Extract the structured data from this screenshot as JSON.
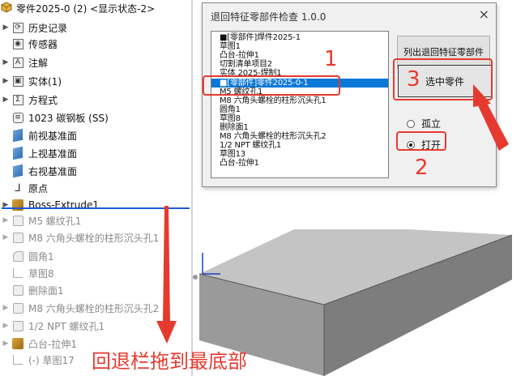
{
  "tree": {
    "header": "零件2025-0 (2) <显示状态-2>",
    "items": [
      {
        "label": "历史记录",
        "icon": "history-icon",
        "expandable": true,
        "dim": false
      },
      {
        "label": "传感器",
        "icon": "sensor-icon",
        "expandable": false,
        "dim": false
      },
      {
        "label": "注解",
        "icon": "annotation-icon",
        "expandable": true,
        "dim": false
      },
      {
        "label": "实体(1)",
        "icon": "solid-bodies-icon",
        "expandable": true,
        "dim": false
      },
      {
        "label": "方程式",
        "icon": "equations-icon",
        "expandable": true,
        "dim": false
      },
      {
        "label": "1023 碳钢板 (SS)",
        "icon": "material-icon",
        "expandable": false,
        "dim": false
      },
      {
        "label": "前视基准面",
        "icon": "plane-icon",
        "expandable": false,
        "dim": false
      },
      {
        "label": "上视基准面",
        "icon": "plane-icon",
        "expandable": false,
        "dim": false
      },
      {
        "label": "右视基准面",
        "icon": "plane-icon",
        "expandable": false,
        "dim": false
      },
      {
        "label": "原点",
        "icon": "origin-icon",
        "expandable": false,
        "dim": false
      },
      {
        "label": "Boss-Extrude1",
        "icon": "extrude-icon",
        "expandable": true,
        "dim": false
      },
      {
        "label": "M5 螺纹孔1",
        "icon": "hole-icon",
        "expandable": true,
        "dim": true
      },
      {
        "label": "M8 六角头螺栓的柱形沉头孔1",
        "icon": "hole-icon",
        "expandable": true,
        "dim": true
      },
      {
        "label": "圆角1",
        "icon": "fillet-icon",
        "expandable": false,
        "dim": true
      },
      {
        "label": "草图8",
        "icon": "sketch-icon",
        "expandable": false,
        "dim": true
      },
      {
        "label": "删除面1",
        "icon": "delete-face-icon",
        "expandable": false,
        "dim": true
      },
      {
        "label": "M8 六角头螺栓的柱形沉头孔2",
        "icon": "hole-icon",
        "expandable": true,
        "dim": true
      },
      {
        "label": "1/2 NPT 螺纹孔1",
        "icon": "hole-icon",
        "expandable": true,
        "dim": true
      },
      {
        "label": "凸台-拉伸1",
        "icon": "extrude-icon",
        "expandable": true,
        "dim": true
      },
      {
        "label": "(-) 草图17",
        "icon": "sketch-icon",
        "expandable": false,
        "dim": true
      }
    ]
  },
  "dialog": {
    "title": "退回特征零部件检查 1.0.0",
    "close": "×",
    "list": [
      "■[零部件]焊件2025-1",
      "草图1",
      "凸台-拉伸1",
      "切割清单项目2",
      "实体 2025-焊制1",
      "■[零部件]零件2025-0-1",
      "M5 螺纹孔1",
      "M8 六角头螺栓的柱形沉头孔1",
      "圆角1",
      "草图8",
      "删除面1",
      "M8 六角头螺栓的柱形沉头孔2",
      "1/2 NPT 螺纹孔1",
      "草图13",
      "凸台-拉伸1"
    ],
    "selected_index": 5,
    "btn_list": "列出退回特征零部件",
    "btn_select": "选中零件",
    "radio_isolate": "孤立",
    "radio_open": "打开",
    "radio_selected": "open"
  },
  "annotations": {
    "step1": "1",
    "step2": "2",
    "step3": "3",
    "caption": "回退栏拖到最底部",
    "color": "#e53a2f"
  }
}
